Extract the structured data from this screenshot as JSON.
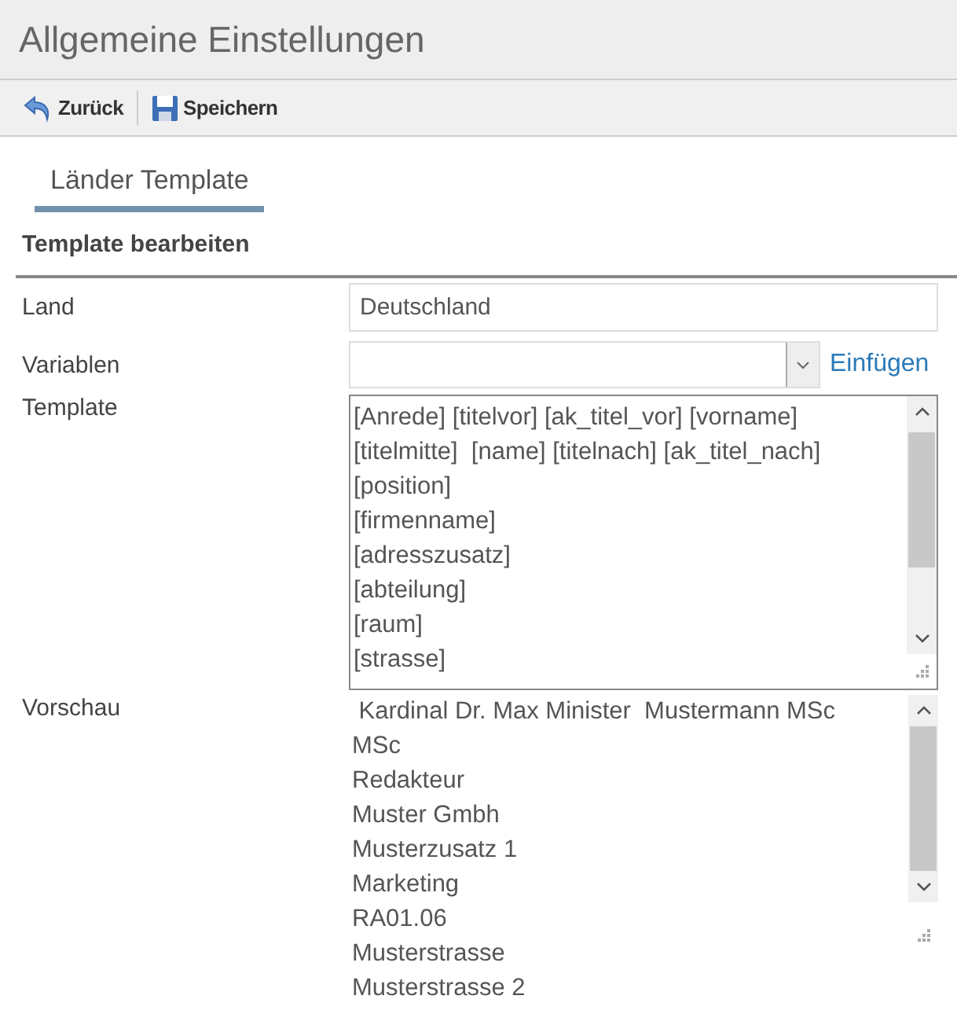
{
  "window": {
    "title": "Allgemeine Einstellungen"
  },
  "toolbar": [
    {
      "kind": "back",
      "label": "Zurück"
    },
    {
      "kind": "save",
      "label": "Speichern"
    }
  ],
  "tabs": [
    {
      "label": "Länder Template",
      "selected": true
    }
  ],
  "section_title": "Template bearbeiten",
  "form": {
    "land": {
      "label": "Land",
      "value": "Deutschland"
    },
    "variablen": {
      "label": "Variablen",
      "link": "Einfügen"
    },
    "template": {
      "label": "Template",
      "lines": [
        "[Anrede] [titelvor] [ak_titel_vor] [vorname]",
        "[titelmitte]  [name] [titelnach] [ak_titel_nach]",
        "[position]",
        "[firmenname]",
        "[adresszusatz]",
        "[abteilung]",
        "[raum]",
        "[strasse]"
      ]
    },
    "vorschau": {
      "label": "Vorschau",
      "lines": [
        " Kardinal Dr. Max Minister  Mustermann MSc",
        "MSc",
        "Redakteur",
        "Muster Gmbh",
        "Musterzusatz 1",
        "Marketing",
        "RA01.06",
        "Musterstrasse",
        "Musterstrasse 2"
      ]
    }
  }
}
